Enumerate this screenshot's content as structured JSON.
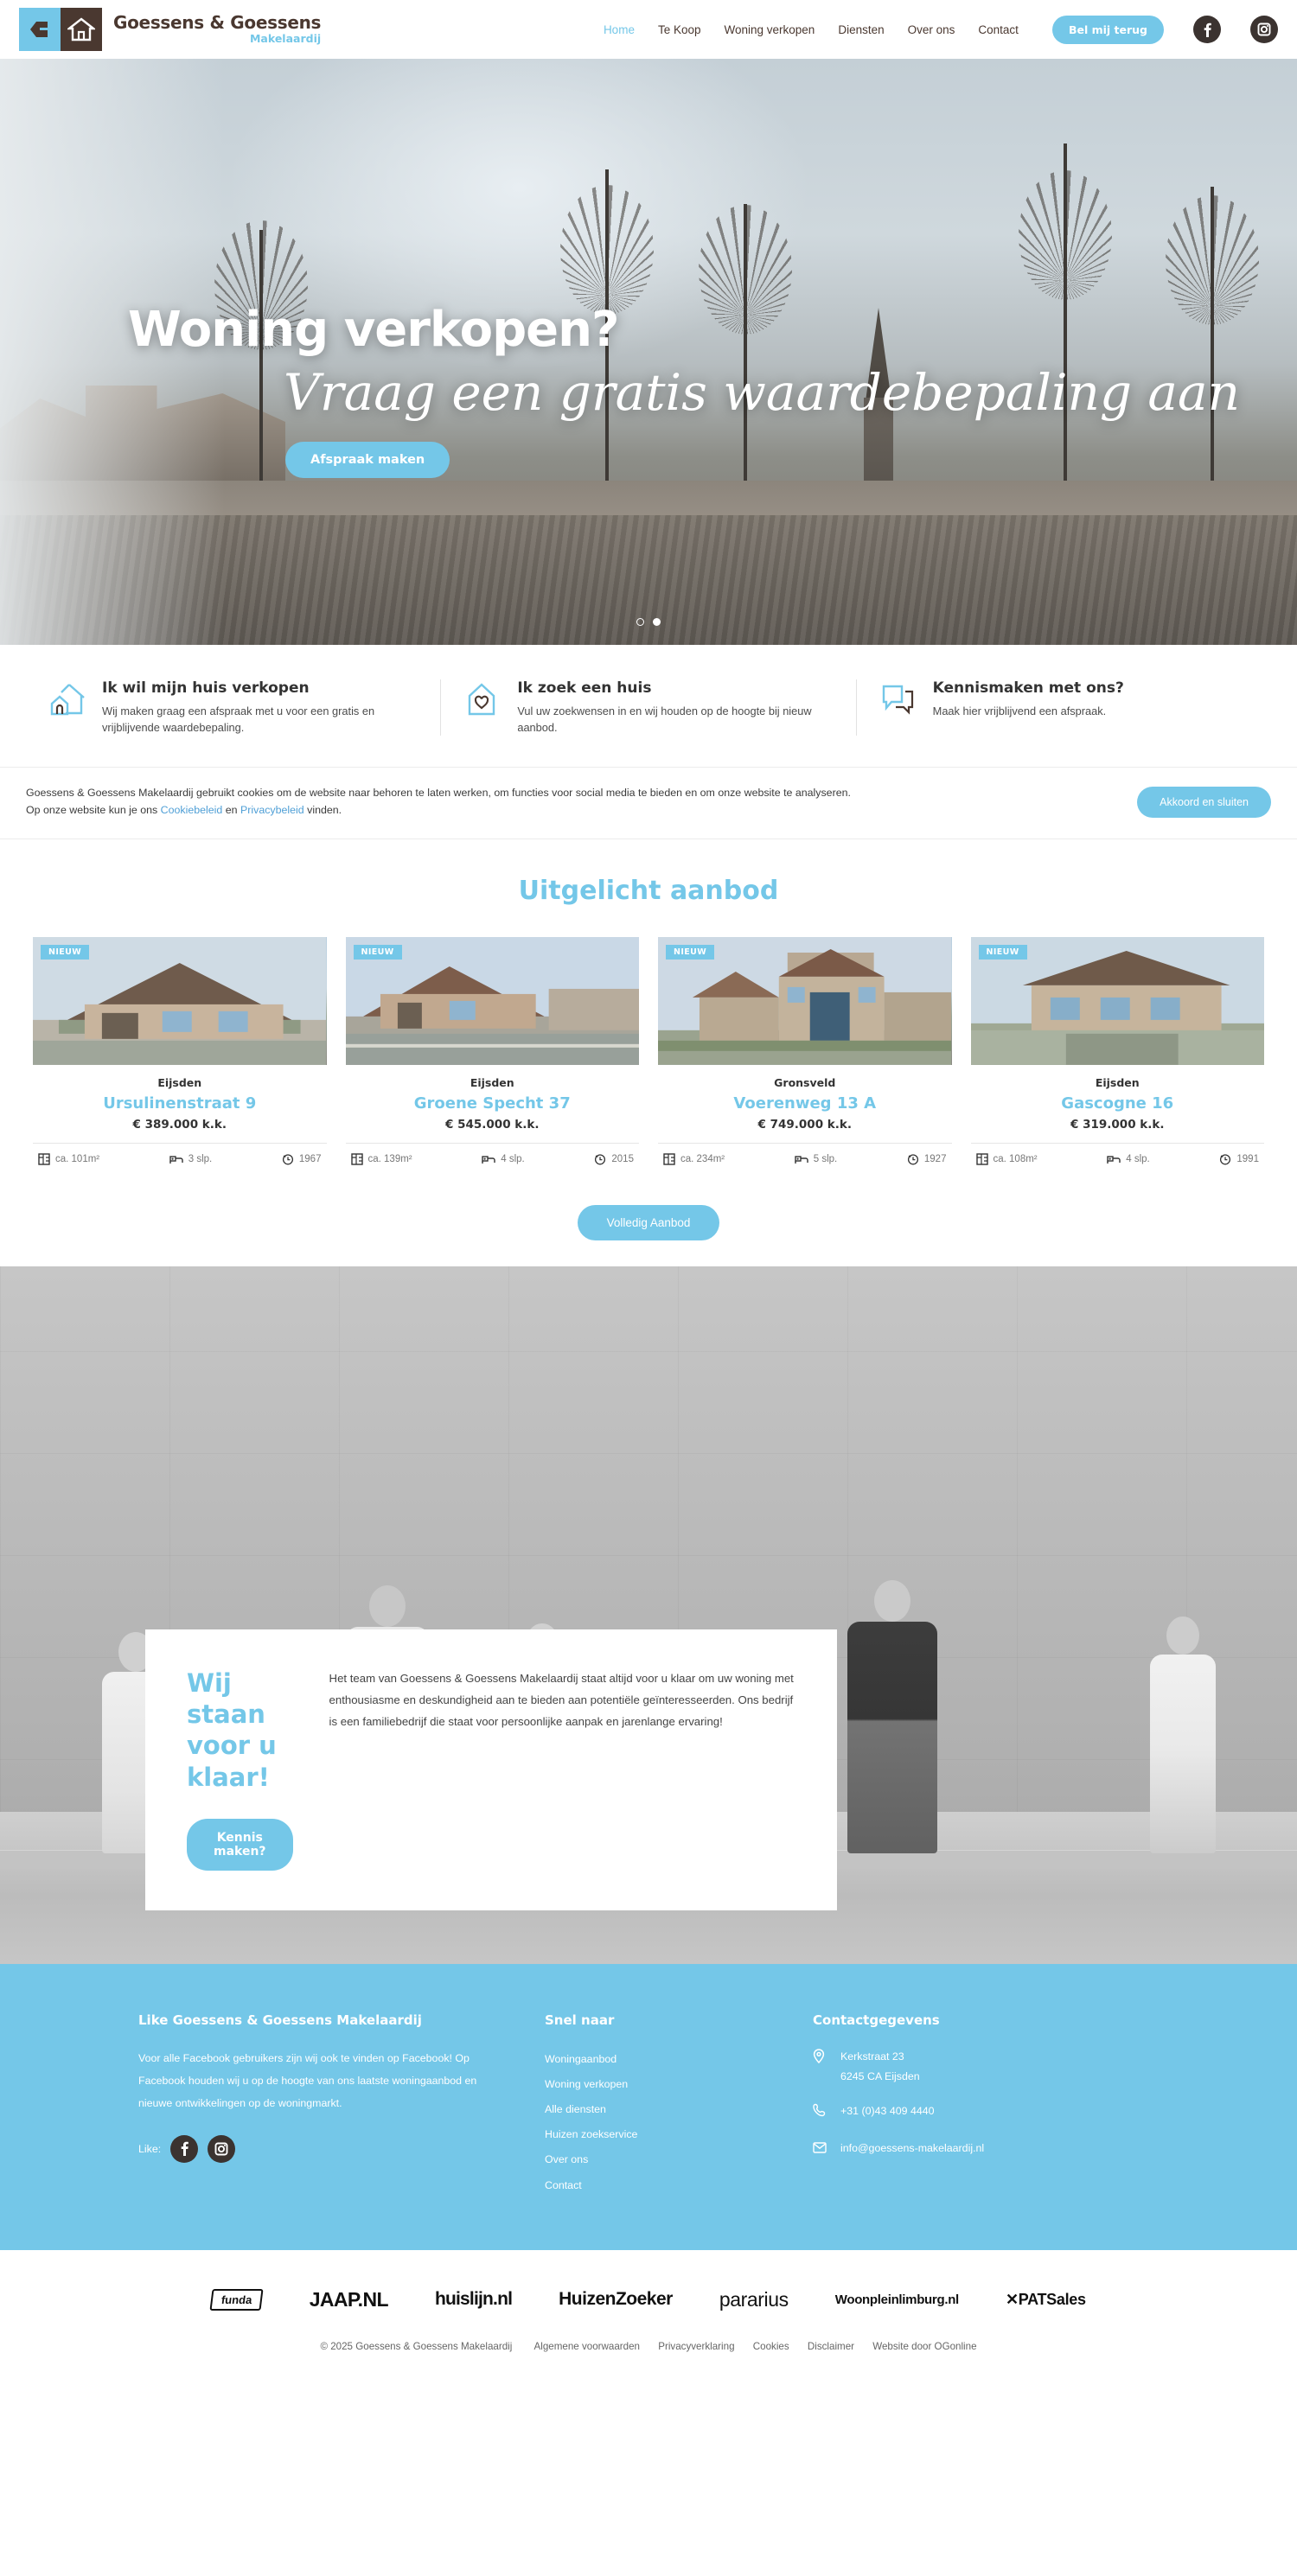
{
  "brand": {
    "name": "Goessens & Goessens",
    "tagline": "Makelaardij",
    "accent": "#74c7e8",
    "dark": "#4a3830"
  },
  "header": {
    "nav": [
      {
        "label": "Home",
        "active": true
      },
      {
        "label": "Te Koop",
        "active": false
      },
      {
        "label": "Woning verkopen",
        "active": false
      },
      {
        "label": "Diensten",
        "active": false
      },
      {
        "label": "Over ons",
        "active": false
      },
      {
        "label": "Contact",
        "active": false
      }
    ],
    "call_button": "Bel mij terug",
    "social": [
      {
        "name": "facebook-icon",
        "glyph": "f"
      },
      {
        "name": "instagram-icon",
        "glyph": "▣"
      }
    ]
  },
  "hero": {
    "title": "Woning verkopen?",
    "subtitle": "Vraag een gratis waardebepaling aan",
    "cta": "Afspraak maken",
    "slides": 2,
    "active_slide": 2
  },
  "features": [
    {
      "icon": "house-outline-icon",
      "title": "Ik wil mijn huis verkopen",
      "text": "Wij maken graag een afspraak met u voor een gratis en vrijblijvende waardebepaling."
    },
    {
      "icon": "house-heart-icon",
      "title": "Ik zoek een huis",
      "text": "Vul uw zoekwensen in en wij houden op de hoogte bij nieuw aanbod."
    },
    {
      "icon": "chat-bubble-icon",
      "title": "Kennismaken met ons?",
      "text": "Maak hier vrijblijvend een afspraak."
    }
  ],
  "cookiebar": {
    "text_1": "Goessens & Goessens Makelaardij gebruikt cookies om de website naar behoren te laten werken, om functies voor social media te bieden en om onze website te analyseren. Op onze website kun je ons ",
    "link_1": "Cookiebeleid",
    "text_2": " en ",
    "link_2": "Privacybeleid",
    "text_3": " vinden.",
    "accept_button": "Akkoord en sluiten"
  },
  "offers": {
    "heading": "Uitgelicht aanbod",
    "badge": "NIEUW",
    "all_button": "Volledig Aanbod",
    "cards": [
      {
        "city": "Eijsden",
        "address": "Ursulinenstraat 9",
        "price": "€ 389.000 k.k.",
        "area": "ca. 101m²",
        "bedrooms": "3 slp.",
        "year": "1967"
      },
      {
        "city": "Eijsden",
        "address": "Groene Specht 37",
        "price": "€ 545.000 k.k.",
        "area": "ca. 139m²",
        "bedrooms": "4 slp.",
        "year": "2015"
      },
      {
        "city": "Gronsveld",
        "address": "Voerenweg 13 A",
        "price": "€ 749.000 k.k.",
        "area": "ca. 234m²",
        "bedrooms": "5 slp.",
        "year": "1927"
      },
      {
        "city": "Eijsden",
        "address": "Gascogne 16",
        "price": "€ 319.000 k.k.",
        "area": "ca. 108m²",
        "bedrooms": "4 slp.",
        "year": "1991"
      }
    ]
  },
  "team": {
    "heading_line_1": "Wij staan",
    "heading_line_2": "voor u klaar!",
    "button": "Kennis maken?",
    "body": "Het team van Goessens & Goessens Makelaardij staat altijd voor u klaar om uw woning met enthousiasme en deskundigheid aan te bieden aan potentiële geïnteresseerden. Ons bedrijf is een familiebedrijf die staat voor persoonlijke aanpak en jarenlange ervaring!"
  },
  "footer": {
    "col1": {
      "title": "Like Goessens & Goessens Makelaardij",
      "text": "Voor alle Facebook gebruikers zijn wij ook te vinden op Facebook! Op Facebook houden wij u op de hoogte van ons laatste woningaanbod en nieuwe ontwikkelingen op de woningmarkt.",
      "like_label": "Like:"
    },
    "col2": {
      "title": "Snel naar",
      "links": [
        "Woningaanbod",
        "Woning verkopen",
        "Alle diensten",
        "Huizen zoekservice",
        "Over ons",
        "Contact"
      ]
    },
    "col3": {
      "title": "Contactgegevens",
      "address_line_1": "Kerkstraat 23",
      "address_line_2": "6245 CA Eijsden",
      "phone": "+31 (0)43 409 4440",
      "email": "info@goessens-makelaardij.nl"
    }
  },
  "partners": [
    "funda",
    "JAAP.NL",
    "huislijn.nl",
    "HuizenZoeker",
    "pararius",
    "Woonpleinlimburg.nl",
    "PATSales"
  ],
  "copyright": {
    "text": "© 2025 Goessens & Goessens Makelaardij",
    "links": [
      "Algemene voorwaarden",
      "Privacyverklaring",
      "Cookies",
      "Disclaimer",
      "Website door OGonline"
    ]
  }
}
